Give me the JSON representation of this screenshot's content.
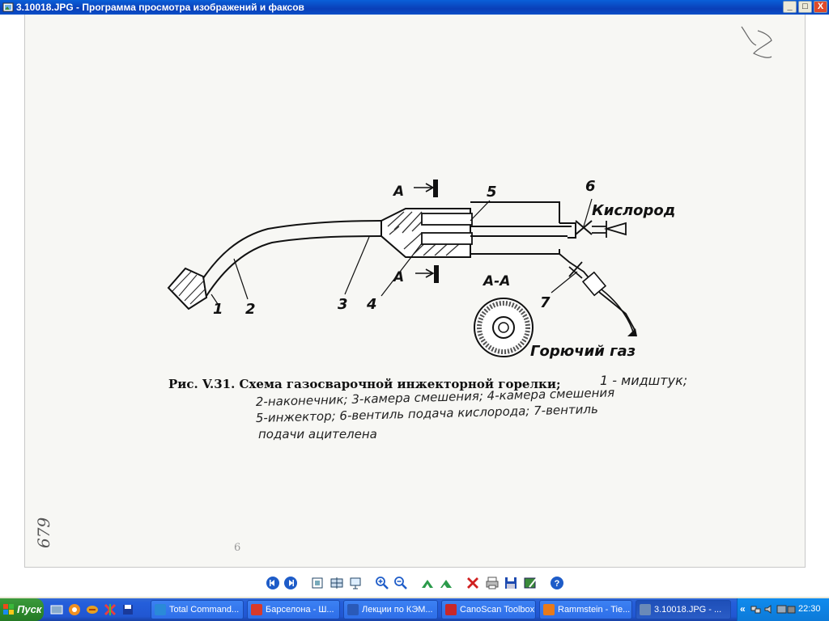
{
  "window": {
    "title": "3.10018.JPG - Программа просмотра изображений и факсов",
    "minimize": "_",
    "maximize": "□",
    "close": "X"
  },
  "scan": {
    "labels": {
      "arrow_a_top": "А",
      "arrow_a_bottom": "А",
      "n1": "1",
      "n2": "2",
      "n3": "3",
      "n4": "4",
      "n5": "5",
      "n6": "6",
      "n7": "7",
      "oxygen": "Кислород",
      "section": "А-А",
      "fuel_gas": "Горючий газ",
      "page_num": "6"
    },
    "caption": {
      "printed": "Рис. V.31. Схема газосварочной инжекторной горелки;",
      "hand_line1": "1 - мидштук;",
      "hand_line2": "2-наконечник; 3-камера смешения; 4-камера смешения",
      "hand_line3": "5-инжектор; 6-вентиль подача кислорода; 7-вентиль",
      "hand_line4": "подачи ацителена"
    },
    "margin_note": "679"
  },
  "toolbar": {
    "tools": [
      "prev-icon",
      "next-icon",
      "best-fit-icon",
      "actual-size-icon",
      "slideshow-icon",
      "zoom-in-icon",
      "zoom-out-icon",
      "rotate-cw-icon",
      "rotate-ccw-icon",
      "delete-icon",
      "print-icon",
      "save-icon",
      "edit-icon",
      "help-icon"
    ]
  },
  "taskbar": {
    "start": "Пуск",
    "tasks": [
      {
        "label": "Total Command...",
        "color": "#2a8ad8"
      },
      {
        "label": "Барселона - Ш...",
        "color": "#d83a2a"
      },
      {
        "label": "Лекции по КЭМ...",
        "color": "#2a5ab8"
      },
      {
        "label": "CanoScan Toolbox",
        "color": "#c8282a"
      },
      {
        "label": "Rammstein - Tie...",
        "color": "#e87a1a"
      },
      {
        "label": "3.10018.JPG - ...",
        "color": "#6a8ab8"
      }
    ],
    "tray_expand": "«",
    "clock": "22:30"
  }
}
